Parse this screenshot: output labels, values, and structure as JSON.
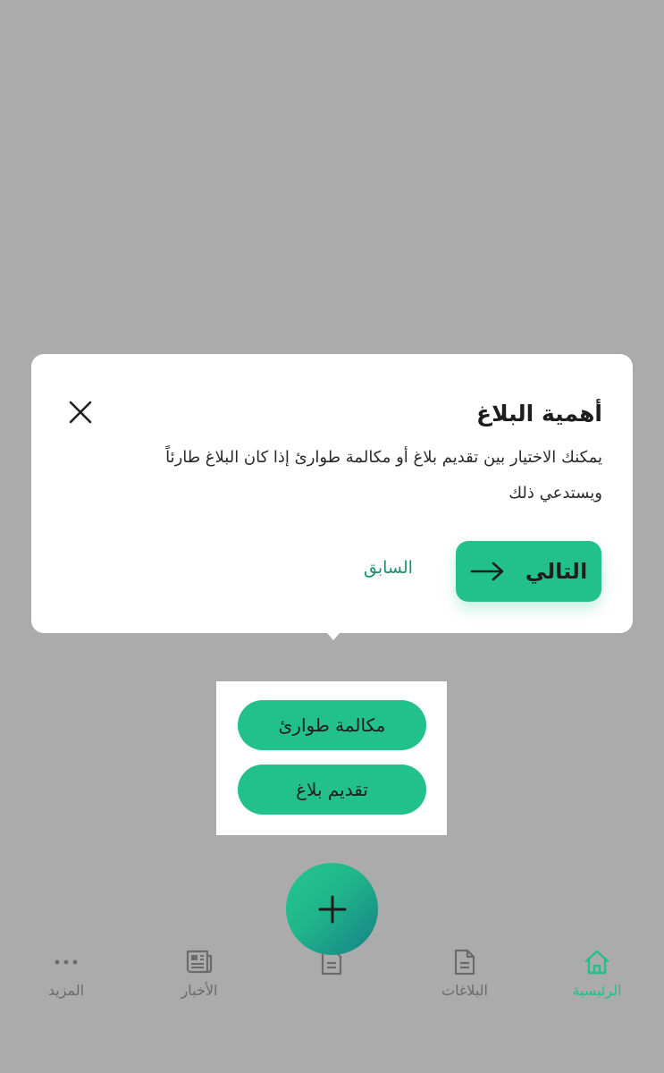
{
  "tooltip": {
    "title": "أهمية البلاغ",
    "body": "يمكنك الاختيار بين تقديم بلاغ أو مكالمة طوارئ إذا كان البلاغ طارئاً ويستدعي ذلك",
    "next_label": "التالي",
    "previous_label": "السابق",
    "close_icon": "close-icon",
    "next_icon": "arrow-right-icon"
  },
  "actions": {
    "emergency_call": "مكالمة طوارئ",
    "submit_report": "تقديم بلاغ"
  },
  "fab": {
    "icon": "plus-icon"
  },
  "bottom_nav": {
    "items": [
      {
        "label": "الرئيسية",
        "icon": "home-icon",
        "active": true
      },
      {
        "label": "البلاغات",
        "icon": "document-icon",
        "active": false
      },
      {
        "label": "",
        "icon": "document-icon",
        "active": false
      },
      {
        "label": "الأخبار",
        "icon": "news-icon",
        "active": false
      },
      {
        "label": "المزيد",
        "icon": "more-dots-icon",
        "active": false
      }
    ]
  },
  "colors": {
    "accent": "#22c08b",
    "overlay": "#ababab",
    "link": "#1e8f6e"
  }
}
